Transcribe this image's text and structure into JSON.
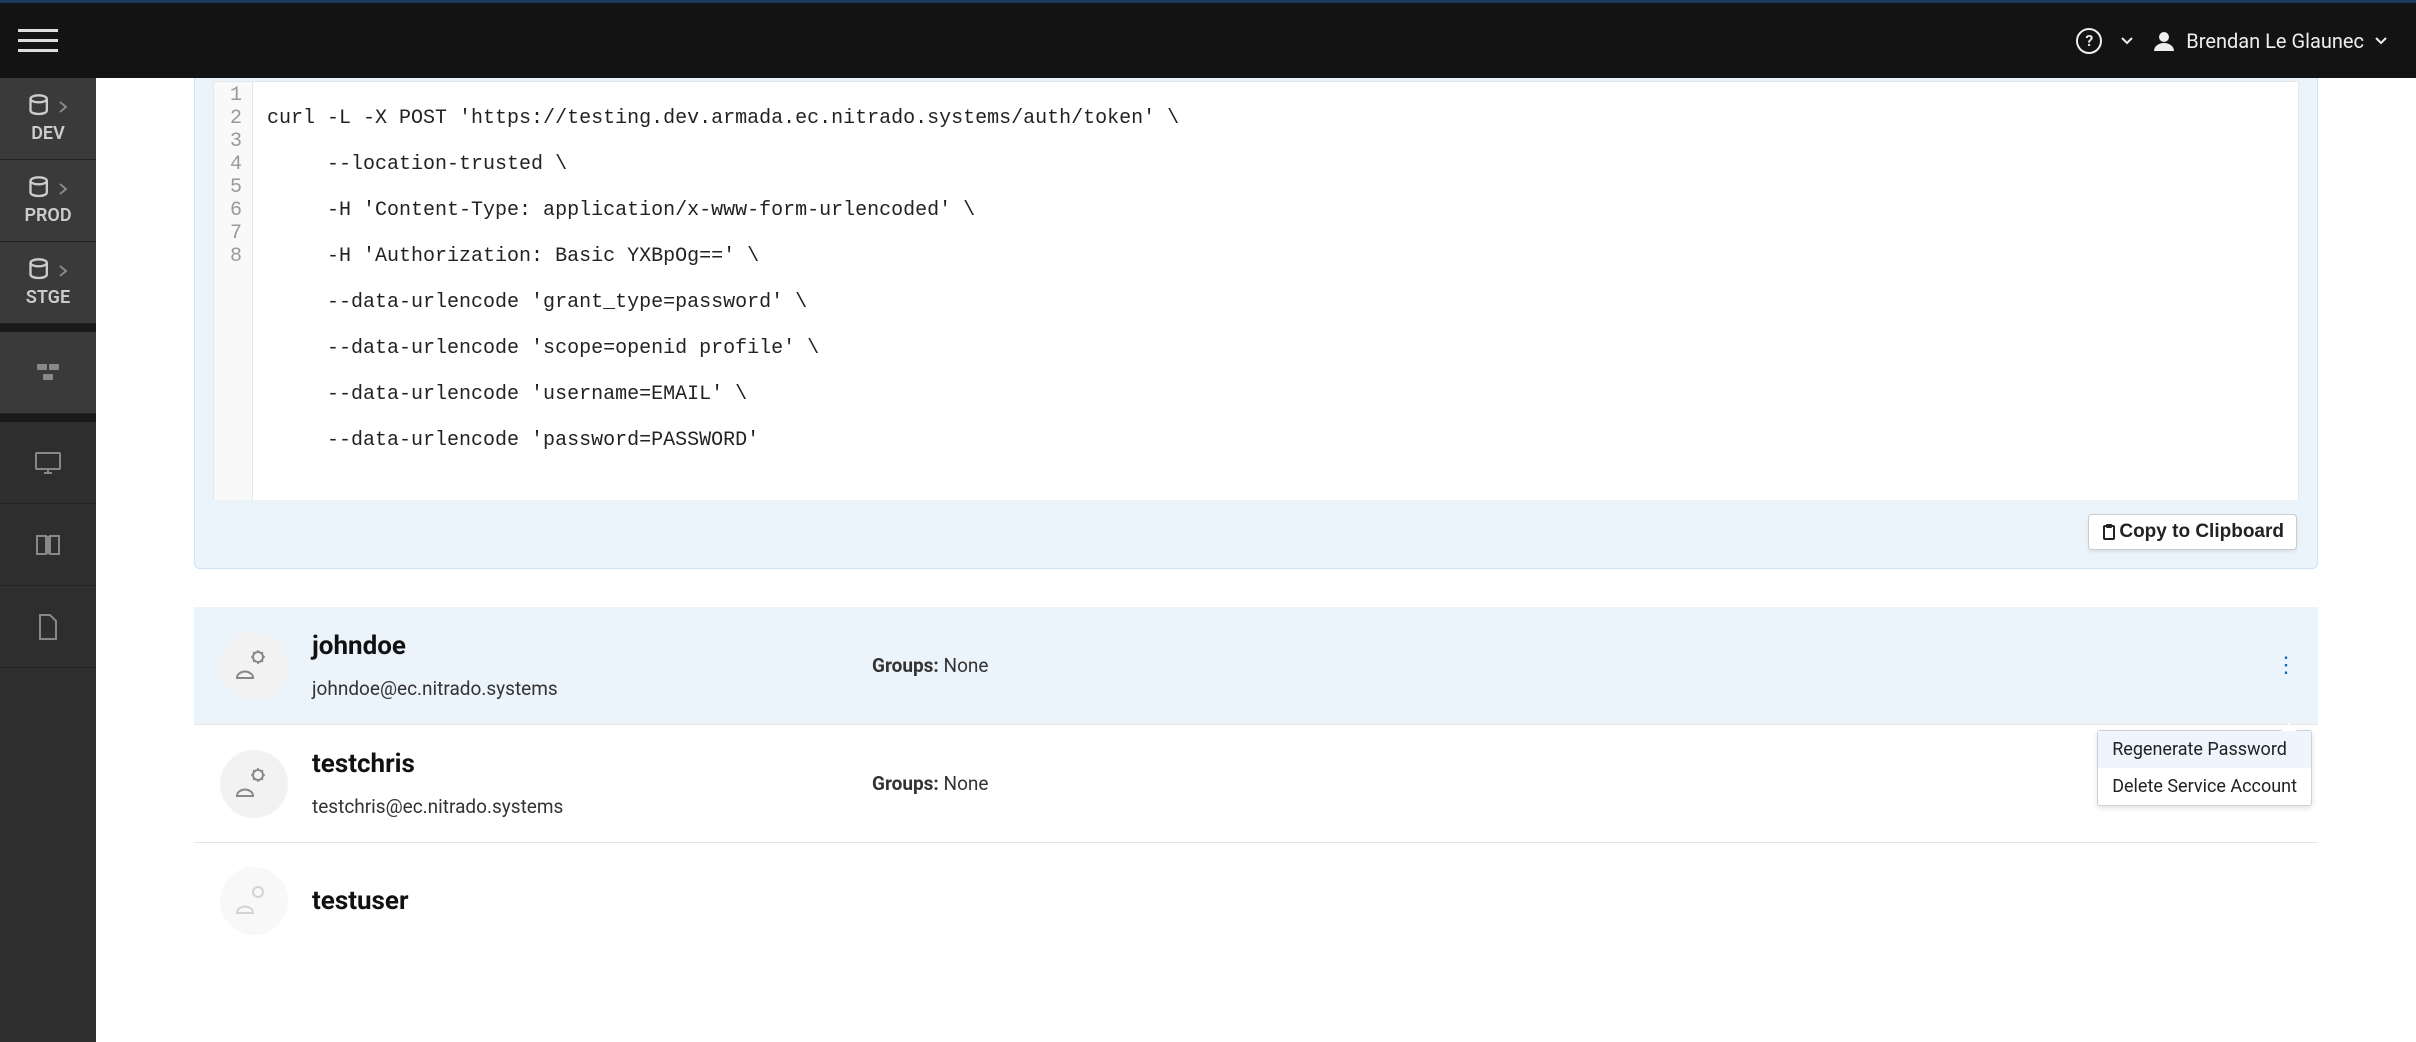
{
  "topbar": {
    "user_name": "Brendan Le Glaunec"
  },
  "sidebar": {
    "envs": [
      "DEV",
      "PROD",
      "STGE"
    ]
  },
  "code": {
    "lines": [
      "curl -L -X POST 'https://testing.dev.armada.ec.nitrado.systems/auth/token' \\",
      "     --location-trusted \\",
      "     -H 'Content-Type: application/x-www-form-urlencoded' \\",
      "     -H 'Authorization: Basic YXBpOg==' \\",
      "     --data-urlencode 'grant_type=password' \\",
      "     --data-urlencode 'scope=openid profile' \\",
      "     --data-urlencode 'username=EMAIL' \\",
      "     --data-urlencode 'password=PASSWORD'"
    ],
    "line_numbers": [
      "1",
      "2",
      "3",
      "4",
      "5",
      "6",
      "7",
      "8"
    ],
    "copy_label": "Copy to Clipboard"
  },
  "accounts": [
    {
      "name": "johndoe",
      "email": "johndoe@ec.nitrado.systems",
      "groups_label": "Groups:",
      "groups_value": "None",
      "selected": true,
      "menu_open": true
    },
    {
      "name": "testchris",
      "email": "testchris@ec.nitrado.systems",
      "groups_label": "Groups:",
      "groups_value": "None",
      "selected": false,
      "menu_open": false
    },
    {
      "name": "testuser",
      "email": "",
      "groups_label": "",
      "groups_value": "",
      "selected": false,
      "menu_open": false
    }
  ],
  "dropdown": {
    "regen": "Regenerate Password",
    "delete": "Delete Service Account"
  }
}
